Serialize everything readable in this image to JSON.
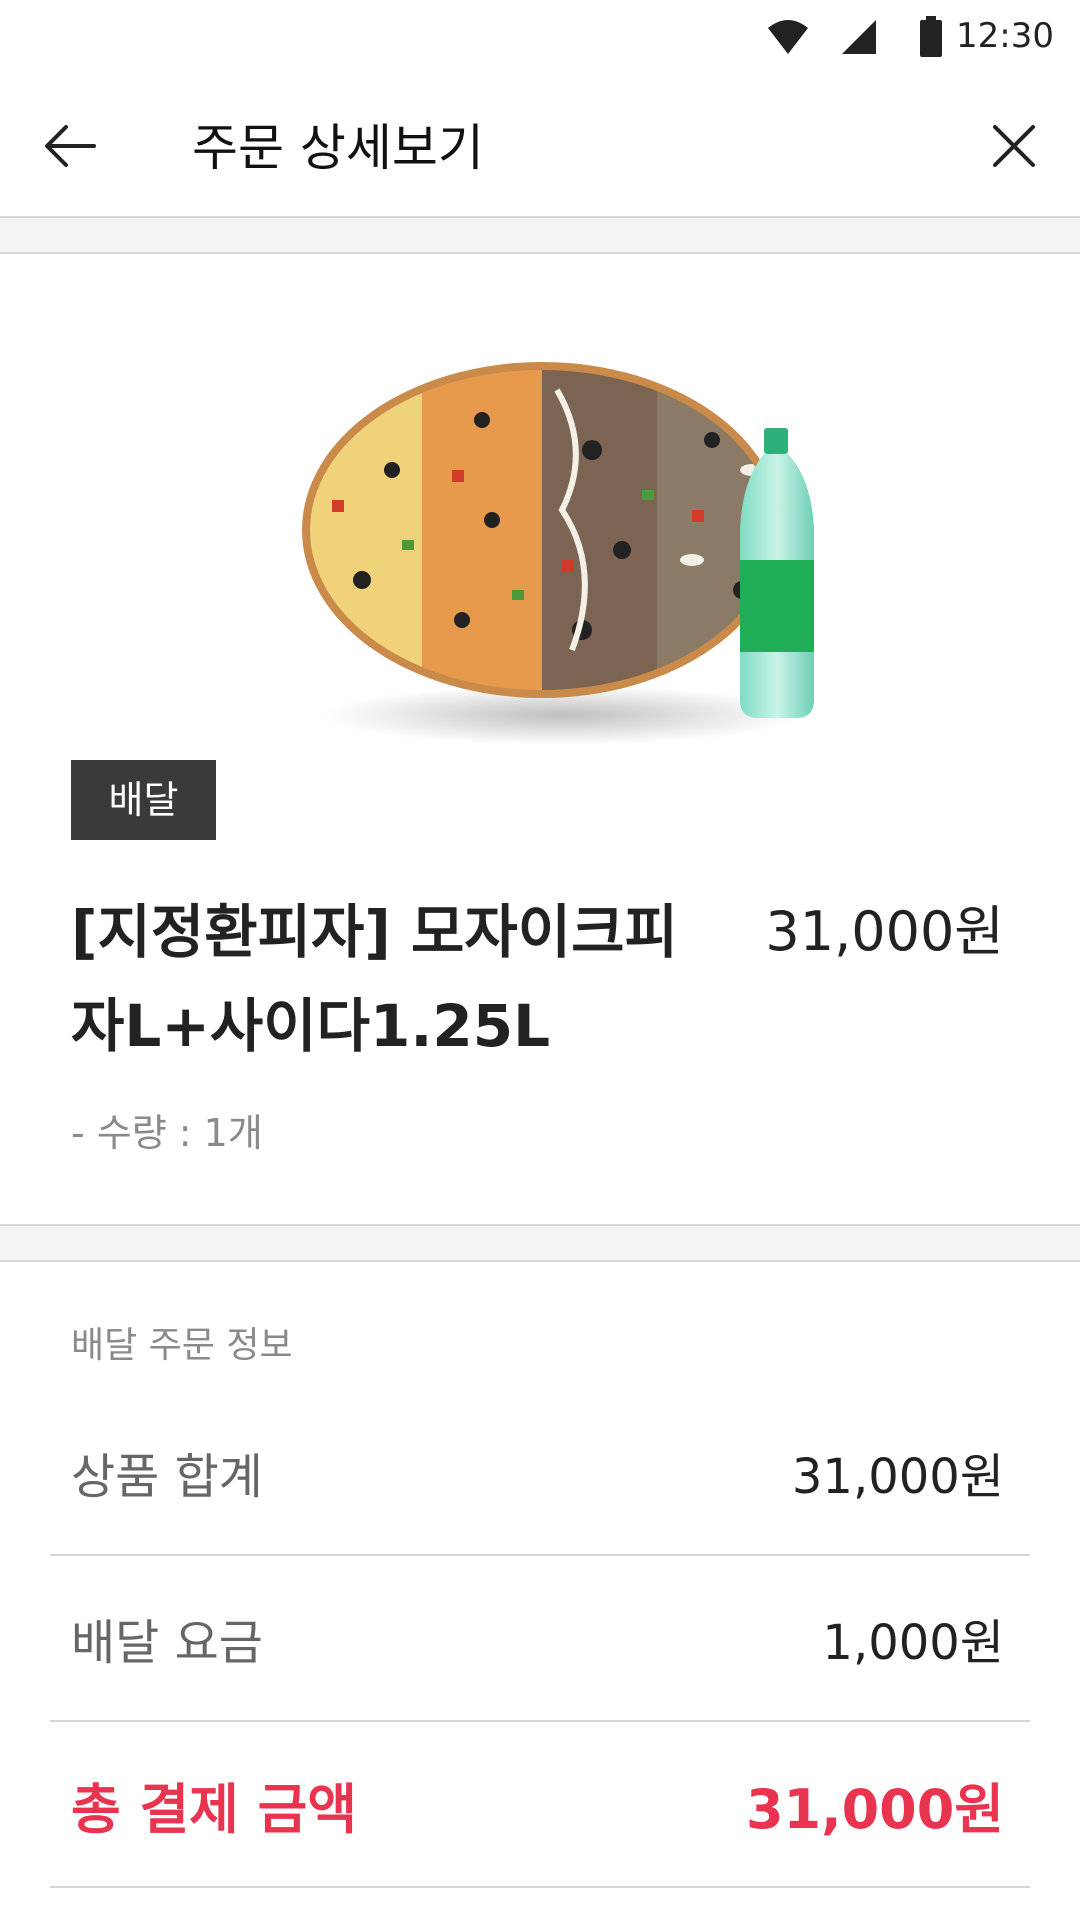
{
  "status_bar": {
    "time": "12:30",
    "icons": [
      "wifi-icon",
      "cellular-signal-icon",
      "battery-icon"
    ]
  },
  "header": {
    "back_icon": "arrow-left-icon",
    "title": "주문 상세보기",
    "close_icon": "close-icon"
  },
  "product": {
    "image": "pizza-and-cider-image",
    "badge": "배달",
    "name": "[지정환피자] 모자이크피자L+사이다1.25L",
    "price": "31,000원",
    "quantity": "- 수량 : 1개"
  },
  "order_info": {
    "section_title": "배달 주문 정보",
    "rows": [
      {
        "label": "상품 합계",
        "value": "31,000원"
      },
      {
        "label": "배달 요금",
        "value": "1,000원"
      }
    ],
    "total": {
      "label": "총 결제 금액",
      "value": "31,000원"
    }
  },
  "colors": {
    "accent": "#e8344e",
    "badge_bg": "#3a3a3a"
  }
}
